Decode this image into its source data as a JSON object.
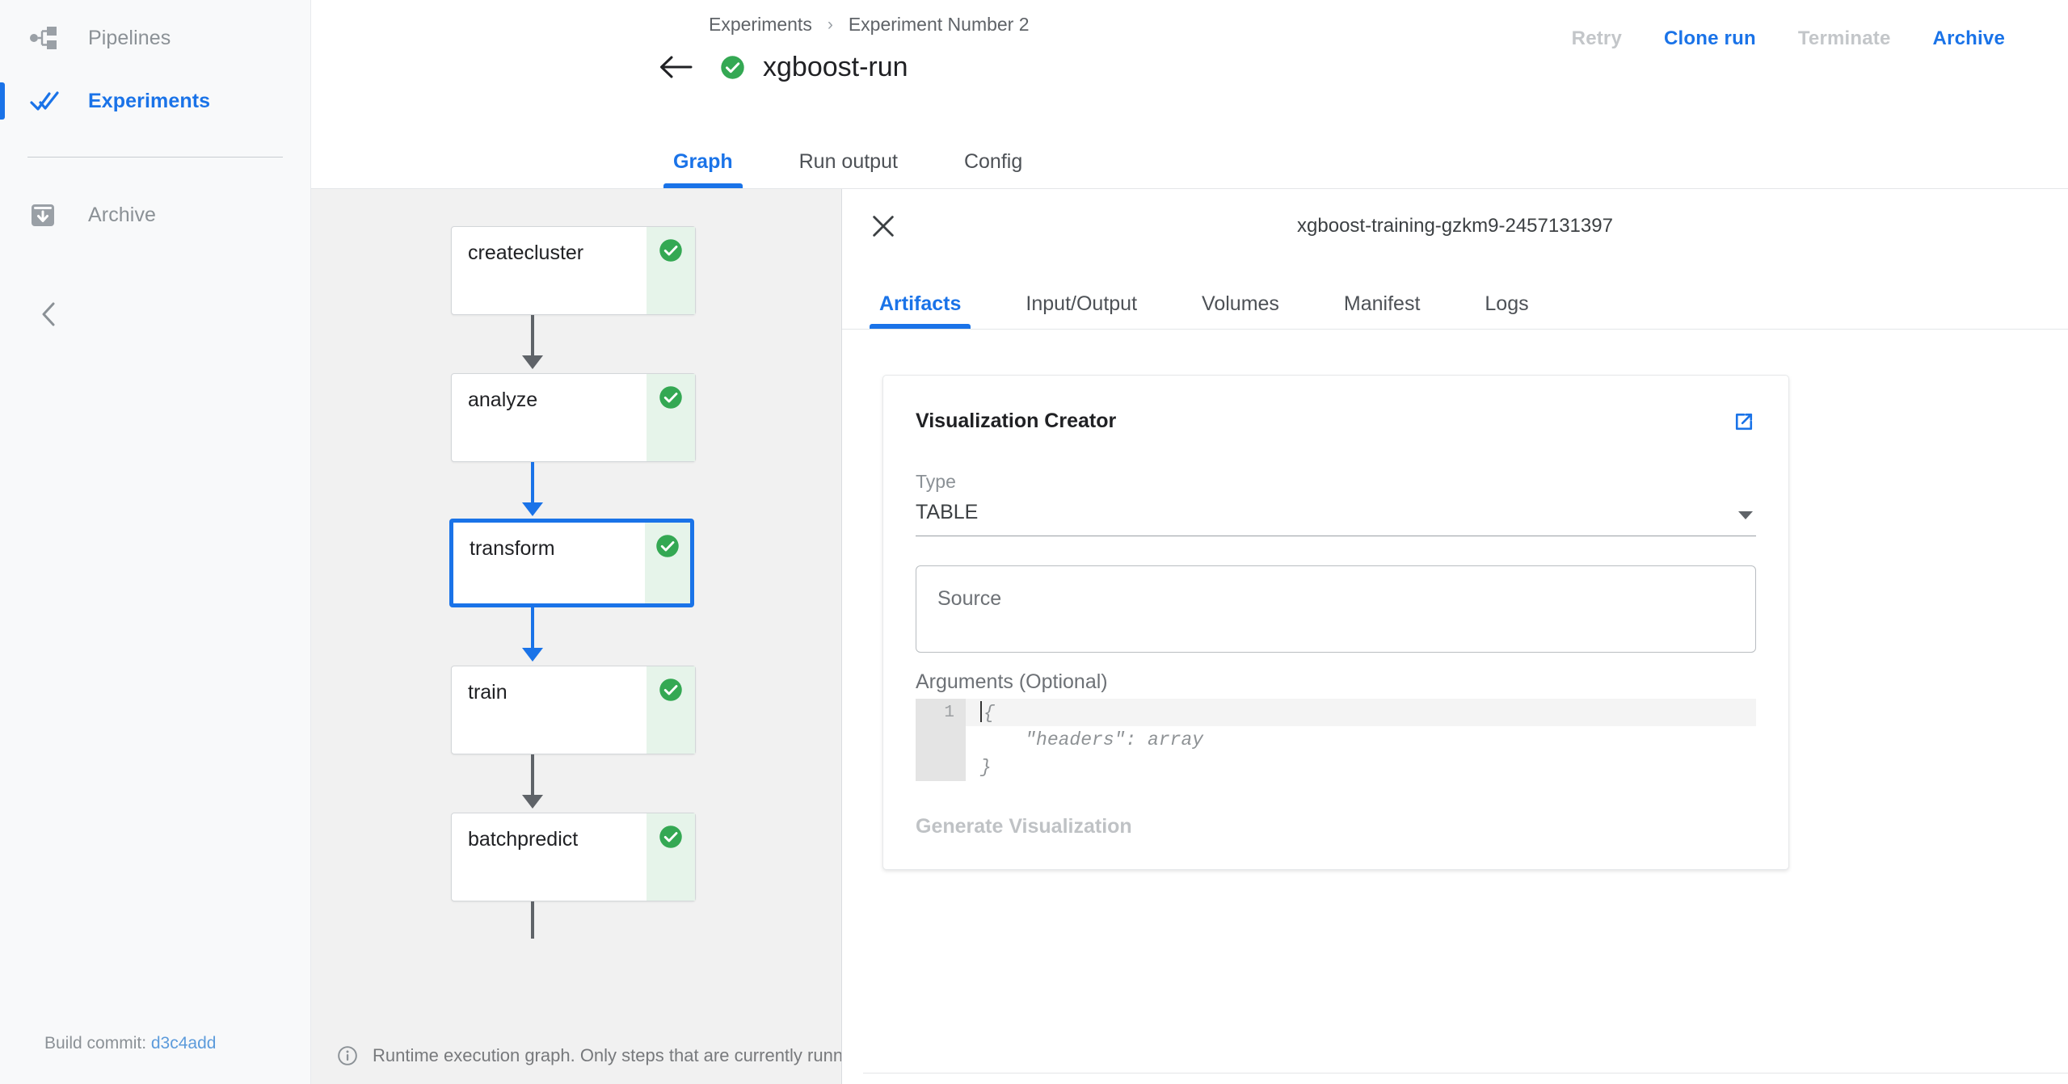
{
  "colors": {
    "accent": "#1a73e8",
    "success": "#34a853",
    "success_bg": "#e6f4ea",
    "disabled": "#c3c6c9",
    "muted": "#8b9196",
    "canvas": "#f1f1f1"
  },
  "sidebar": {
    "items": [
      {
        "label": "Pipelines",
        "icon": "pipelines-icon",
        "active": false
      },
      {
        "label": "Experiments",
        "icon": "experiments-icon",
        "active": true
      },
      {
        "label": "Archive",
        "icon": "archive-icon",
        "active": false
      }
    ],
    "collapse_icon": "chevron-left-icon",
    "build_commit_label": "Build commit:",
    "build_commit_value": "d3c4add"
  },
  "header": {
    "breadcrumb": [
      {
        "label": "Experiments"
      },
      {
        "label": "Experiment Number 2"
      }
    ],
    "breadcrumb_separator": "›",
    "back_icon": "back-arrow-icon",
    "status_icon": "success-check-icon",
    "run_title": "xgboost-run",
    "actions": [
      {
        "label": "Retry",
        "enabled": false
      },
      {
        "label": "Clone run",
        "enabled": true
      },
      {
        "label": "Terminate",
        "enabled": false
      },
      {
        "label": "Archive",
        "enabled": true
      }
    ]
  },
  "main_tabs": [
    {
      "label": "Graph",
      "active": true
    },
    {
      "label": "Run output",
      "active": false
    },
    {
      "label": "Config",
      "active": false
    }
  ],
  "graph": {
    "nodes": [
      {
        "label": "createcluster",
        "status": "succeeded",
        "selected": false
      },
      {
        "label": "analyze",
        "status": "succeeded",
        "selected": false
      },
      {
        "label": "transform",
        "status": "succeeded",
        "selected": true
      },
      {
        "label": "train",
        "status": "succeeded",
        "selected": false
      },
      {
        "label": "batchpredict",
        "status": "succeeded",
        "selected": false
      }
    ],
    "edges": [
      {
        "from": "createcluster",
        "to": "analyze",
        "color": "gray"
      },
      {
        "from": "analyze",
        "to": "transform",
        "color": "blue"
      },
      {
        "from": "transform",
        "to": "train",
        "color": "blue"
      },
      {
        "from": "train",
        "to": "batchpredict",
        "color": "gray"
      }
    ],
    "legend_icon": "info-icon",
    "legend_text": "Runtime execution graph. Only steps that are currently runni"
  },
  "side_panel": {
    "close_icon": "close-icon",
    "title": "xgboost-training-gzkm9-2457131397",
    "tabs": [
      {
        "label": "Artifacts",
        "active": true
      },
      {
        "label": "Input/Output",
        "active": false
      },
      {
        "label": "Volumes",
        "active": false
      },
      {
        "label": "Manifest",
        "active": false
      },
      {
        "label": "Logs",
        "active": false
      }
    ],
    "visualization_creator": {
      "title": "Visualization Creator",
      "external_link_icon": "external-link-icon",
      "type_label": "Type",
      "type_value": "TABLE",
      "type_caret_icon": "chevron-down-icon",
      "source_placeholder": "Source",
      "source_value": "",
      "arguments_label": "Arguments (Optional)",
      "editor_line_number": "1",
      "editor_lines": [
        "{",
        "    \"headers\": array",
        "}"
      ],
      "generate_button_label": "Generate Visualization",
      "generate_button_enabled": false
    }
  }
}
